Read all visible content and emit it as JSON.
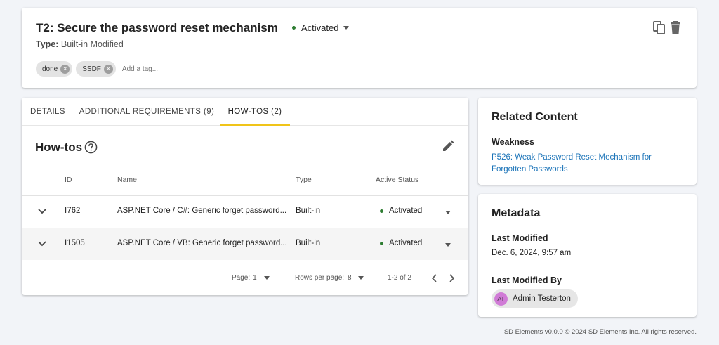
{
  "header": {
    "title": "T2: Secure the password reset mechanism",
    "status": "Activated",
    "type_label": "Type:",
    "type_value": "Built-in Modified",
    "tags": [
      "done",
      "SSDF"
    ],
    "tag_placeholder": "Add a tag..."
  },
  "tabs": [
    {
      "label": "DETAILS"
    },
    {
      "label": "ADDITIONAL REQUIREMENTS (9)"
    },
    {
      "label": "HOW-TOS (2)"
    }
  ],
  "active_tab": "HOW-TOS (2)",
  "howtos": {
    "title": "How-tos",
    "columns": [
      "ID",
      "Name",
      "Type",
      "Active Status"
    ],
    "rows": [
      {
        "id": "I762",
        "name": "ASP.NET Core / C#: Generic forget password...",
        "type": "Built-in",
        "status": "Activated"
      },
      {
        "id": "I1505",
        "name": "ASP.NET Core / VB: Generic forget password...",
        "type": "Built-in",
        "status": "Activated"
      }
    ],
    "pagination": {
      "page_label": "Page:",
      "page": "1",
      "rows_label": "Rows per page:",
      "rows_per_page": "8",
      "range": "1-2 of 2"
    }
  },
  "related": {
    "title": "Related Content",
    "weakness_label": "Weakness",
    "weakness_link": "P526: Weak Password Reset Mechanism for Forgotten Passwords"
  },
  "metadata": {
    "title": "Metadata",
    "last_modified_label": "Last Modified",
    "last_modified": "Dec. 6, 2024, 9:57 am",
    "last_modified_by_label": "Last Modified By",
    "user_initials": "AT",
    "user_name": "Admin Testerton"
  },
  "footer": {
    "copyright": "SD Elements v0.0.0 © 2024 SD Elements Inc. All rights reserved."
  },
  "colors": {
    "accent_tab": "#f0c419",
    "status_green": "#2e7d32",
    "link": "#1a73b8",
    "avatar": "#d07bd6"
  }
}
